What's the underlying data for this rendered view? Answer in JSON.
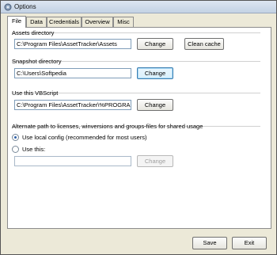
{
  "window": {
    "title": "Options"
  },
  "tabs": [
    {
      "label": "File",
      "active": true
    },
    {
      "label": "Data",
      "active": false
    },
    {
      "label": "Credentials",
      "active": false
    },
    {
      "label": "Overview",
      "active": false
    },
    {
      "label": "Misc",
      "active": false
    }
  ],
  "assets": {
    "label": "Assets directory",
    "path": "C:\\Program Files\\AssetTracker\\Assets",
    "change_label": "Change",
    "clean_cache_label": "Clean cache"
  },
  "snapshot": {
    "label": "Snapshot directory",
    "path": "C:\\Users\\Softpedia",
    "change_label": "Change"
  },
  "vbscript": {
    "label": "Use this VBScript",
    "path": "C:\\Program Files\\AssetTracker\\%PROGRAMFILES",
    "change_label": "Change"
  },
  "alternate": {
    "label": "Alternate path to licenses, winversions and groups-files for shared usage",
    "option_local": "Use local config (recommended for most users)",
    "option_custom": "Use this:",
    "selected": "local",
    "custom_path": "",
    "change_label": "Change"
  },
  "footer": {
    "save_label": "Save",
    "exit_label": "Exit"
  }
}
